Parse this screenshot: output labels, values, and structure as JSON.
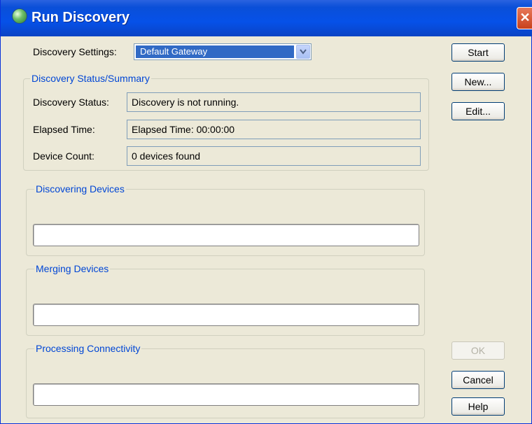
{
  "window": {
    "title": "Run Discovery",
    "close_glyph": "✕",
    "app_icon": "discovery-globe-icon"
  },
  "settings": {
    "label": "Discovery Settings:",
    "selected": "Default Gateway"
  },
  "status_group": {
    "title": "Discovery Status/Summary",
    "rows": [
      {
        "label": "Discovery Status:",
        "value": "Discovery is not running."
      },
      {
        "label": "Elapsed Time:",
        "value": "Elapsed Time: 00:00:00"
      },
      {
        "label": "Device Count:",
        "value": "0 devices found"
      }
    ]
  },
  "progress_groups": [
    {
      "title": "Discovering Devices",
      "progress": 0
    },
    {
      "title": "Merging Devices",
      "progress": 0
    },
    {
      "title": "Processing Connectivity",
      "progress": 0
    }
  ],
  "buttons": {
    "start": "Start",
    "new": "New...",
    "edit": "Edit...",
    "ok": "OK",
    "cancel": "Cancel",
    "help": "Help"
  },
  "colors": {
    "titlebar": "#0a4fd8",
    "dialog_bg": "#ece9d8",
    "group_title": "#0046d5",
    "selection": "#316ac5"
  }
}
